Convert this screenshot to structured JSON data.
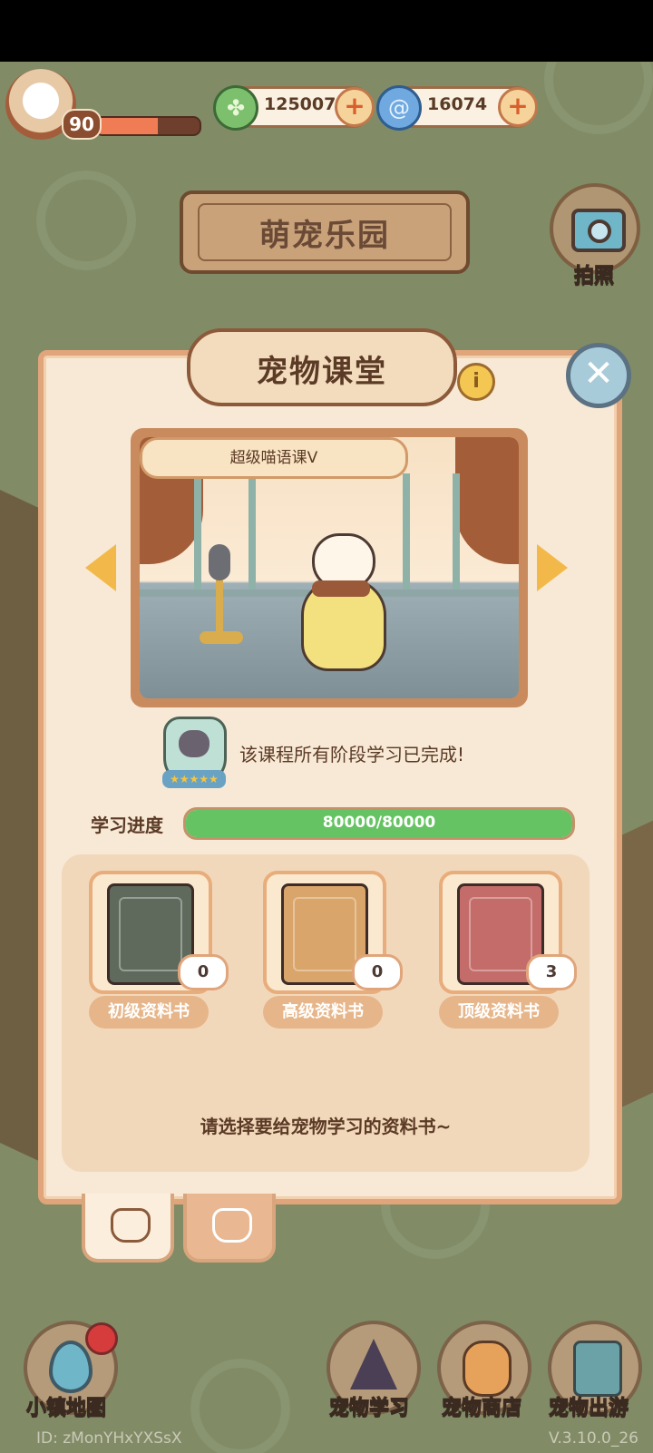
{
  "player": {
    "level": "90",
    "xp_fraction": 0.6
  },
  "currencies": [
    {
      "icon": "clover-icon",
      "value": "125007"
    },
    {
      "icon": "spiral-gem-icon",
      "value": "16074"
    }
  ],
  "header": {
    "title": "萌宠乐园",
    "camera_label": "拍照"
  },
  "panel": {
    "title": "宠物课堂",
    "lesson_name": "超级喵语课Ⅴ",
    "completion_message": "该课程所有阶段学习已完成!",
    "progress_label": "学习进度",
    "progress_text": "80000/80000",
    "progress_fraction": 1.0,
    "books": [
      {
        "label": "初级资料书",
        "count": "0",
        "color": "green"
      },
      {
        "label": "高级资料书",
        "count": "0",
        "color": "orange"
      },
      {
        "label": "顶级资料书",
        "count": "3",
        "color": "red"
      }
    ],
    "hint": "请选择要给宠物学习的资料书~"
  },
  "bottom_nav": {
    "map_label": "小镇地图",
    "study_label": "宠物学习",
    "shop_label": "宠物商店",
    "travel_label": "宠物出游"
  },
  "footer": {
    "id": "ID: zMonYHxYXSsX",
    "version": "V.3.10.0_26"
  },
  "colors": {
    "accent": "#f2b94a",
    "progress": "#66c363",
    "panel_border": "#e1a57b"
  }
}
